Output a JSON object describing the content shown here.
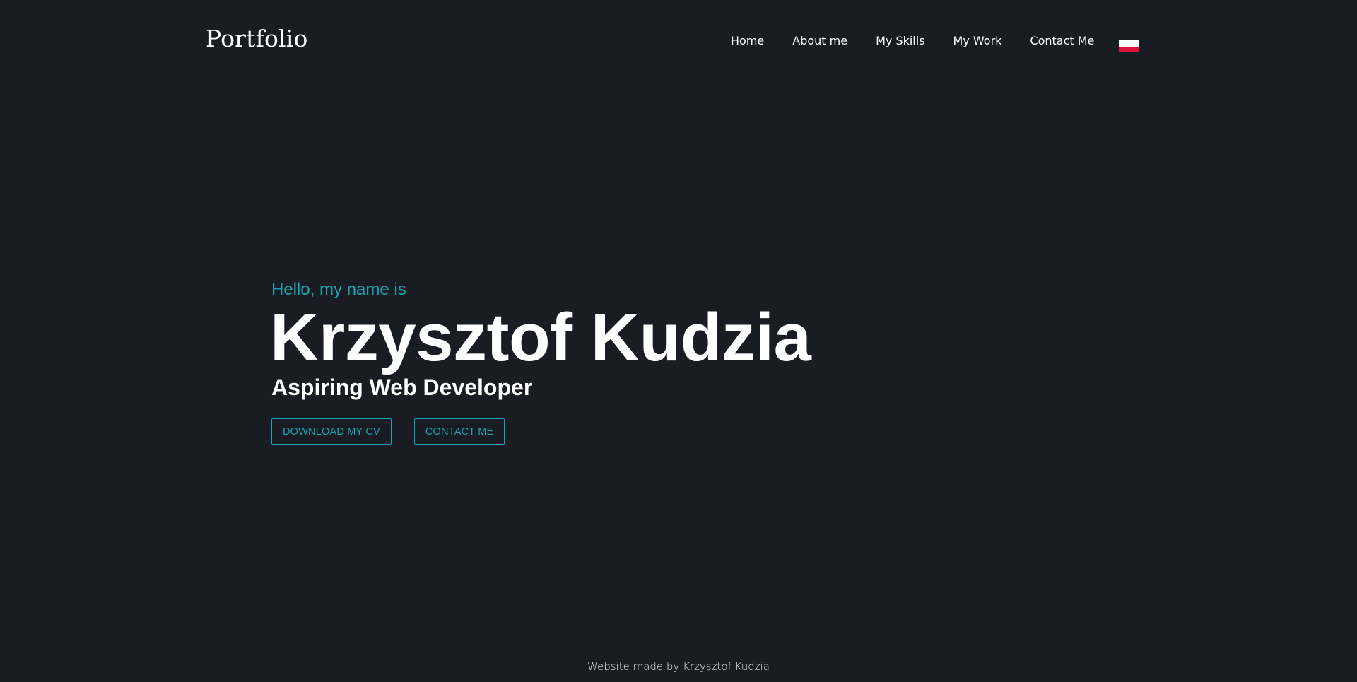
{
  "header": {
    "logo": "Portfolio",
    "nav": [
      {
        "label": "Home"
      },
      {
        "label": "About me"
      },
      {
        "label": "My Skills"
      },
      {
        "label": "My Work"
      },
      {
        "label": "Contact Me"
      }
    ],
    "language_flag": {
      "icon": "poland-flag-icon",
      "colors": [
        "#ffffff",
        "#dc143c"
      ]
    }
  },
  "hero": {
    "greeting": "Hello, my name is",
    "name": "Krzysztof Kudzia",
    "role": "Aspiring Web Developer",
    "buttons": [
      {
        "label": "DOWNLOAD MY CV"
      },
      {
        "label": "CONTACT ME"
      }
    ]
  },
  "footer": {
    "text": "Website made by Krzysztof Kudzia"
  },
  "colors": {
    "background": "#191c23",
    "accent": "#17a5b3",
    "text": "#ffffff"
  }
}
